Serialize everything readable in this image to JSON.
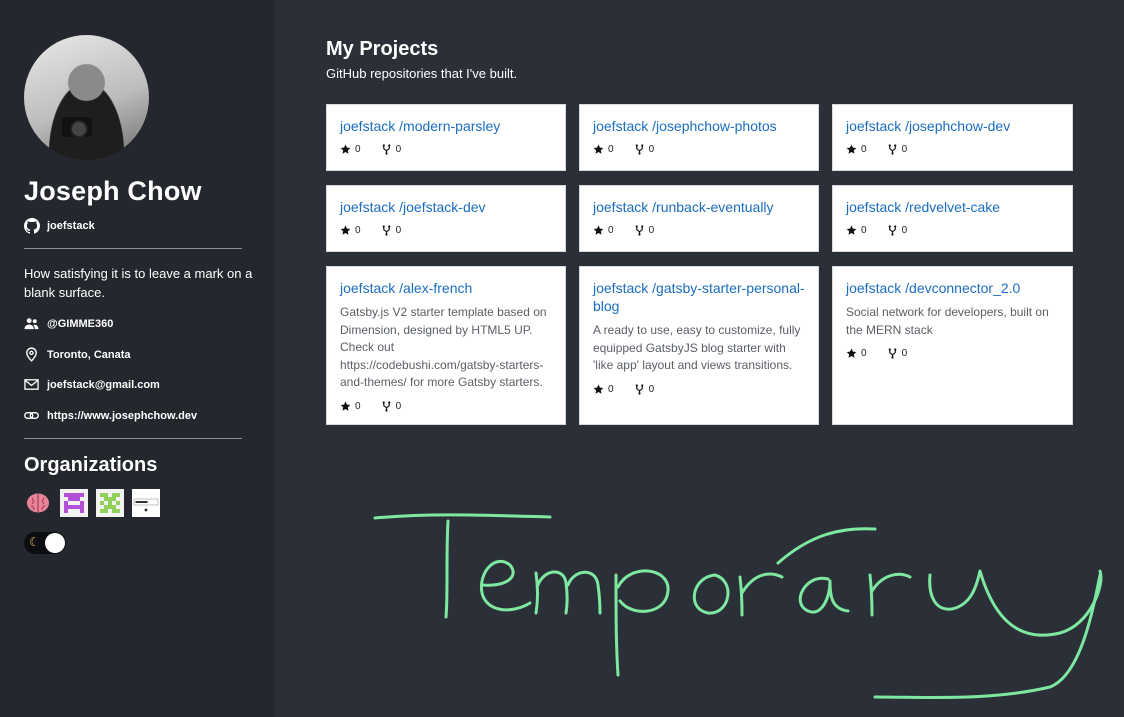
{
  "profile": {
    "name": "Joseph Chow",
    "username": "joefstack",
    "bio": "How satisfying it is to leave a mark on a blank surface.",
    "company": "@GIMME360",
    "location": "Toronto, Canata",
    "email": "joefstack@gmail.com",
    "website": "https://www.josephchow.dev"
  },
  "organizations": {
    "title": "Organizations",
    "items": [
      {
        "icon": "brain-org-icon"
      },
      {
        "icon": "purple-pixel-org-icon"
      },
      {
        "icon": "green-pixel-org-icon"
      },
      {
        "icon": "codebushi-org-icon"
      }
    ]
  },
  "theme_toggle": {
    "icon": "moon-icon",
    "state": "light"
  },
  "main": {
    "title": "My Projects",
    "subtitle": "GitHub repositories that I've built.",
    "repos": [
      {
        "owner": "joefstack ",
        "name": "/modern-parsley",
        "description": "",
        "stars": "0",
        "forks": "0"
      },
      {
        "owner": "joefstack ",
        "name": "/josephchow-photos",
        "description": "",
        "stars": "0",
        "forks": "0"
      },
      {
        "owner": "joefstack ",
        "name": "/josephchow-dev",
        "description": "",
        "stars": "0",
        "forks": "0"
      },
      {
        "owner": "joefstack ",
        "name": "/joefstack-dev",
        "description": "",
        "stars": "0",
        "forks": "0"
      },
      {
        "owner": "joefstack ",
        "name": "/runback-eventually",
        "description": "",
        "stars": "0",
        "forks": "0"
      },
      {
        "owner": "joefstack ",
        "name": "/redvelvet-cake",
        "description": "",
        "stars": "0",
        "forks": "0"
      },
      {
        "owner": "joefstack ",
        "name": "/alex-french",
        "description": "Gatsby.js V2 starter template based on Dimension, designed by HTML5 UP. Check out https://codebushi.com/gatsby-starters-and-themes/ for more Gatsby starters.",
        "stars": "0",
        "forks": "0"
      },
      {
        "owner": "joefstack ",
        "name": "/gatsby-starter-personal-blog",
        "description": "A ready to use, easy to customize, fully equipped GatsbyJS blog starter with 'like app' layout and views transitions.",
        "stars": "0",
        "forks": "0"
      },
      {
        "owner": "joefstack ",
        "name": "/devconnector_2.0",
        "description": "Social network for developers, built on the MERN stack",
        "stars": "0",
        "forks": "0"
      }
    ]
  },
  "overlay": {
    "handwriting": "Temporary",
    "color": "#7ee8a0"
  },
  "colors": {
    "sidebar": "#24272d",
    "main": "#2b3038",
    "link": "#1a6dbf"
  }
}
